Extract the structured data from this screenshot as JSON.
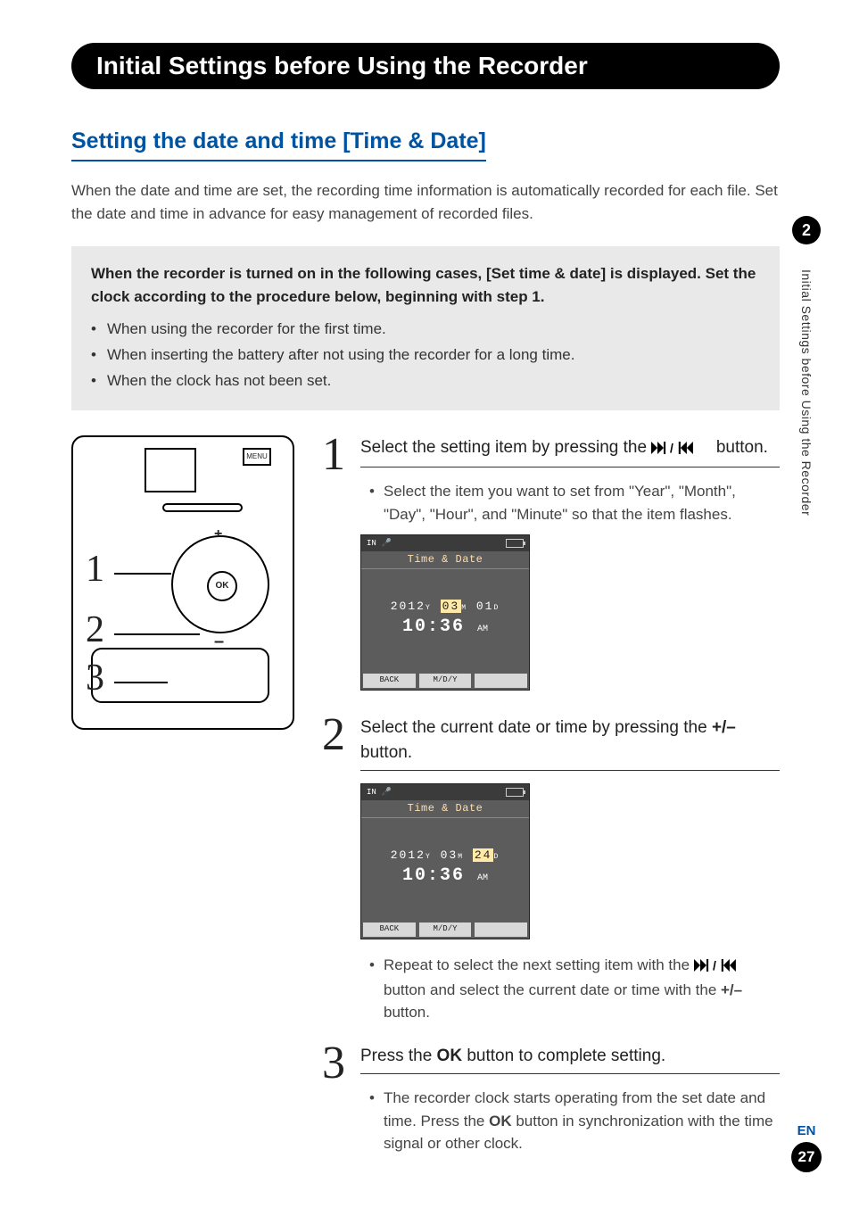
{
  "header": {
    "title": "Initial Settings before Using the Recorder"
  },
  "subheading": "Setting the date and time [Time & Date]",
  "intro": "When the date and time are set, the recording time information is automatically recorded for each file. Set the date and time in advance for easy management of recorded files.",
  "callout": {
    "heading": "When the recorder is turned on in the following cases, [Set time & date] is displayed. Set the clock according to the procedure below, beginning with step 1.",
    "items": [
      "When using the recorder for the first time.",
      "When inserting the battery after not using the recorder for a long time.",
      "When the clock has not been set."
    ]
  },
  "device": {
    "menu_label": "MENU",
    "ok_label": "OK",
    "plus": "+",
    "minus": "–",
    "callouts": {
      "n1": "1",
      "n2": "2",
      "n3": "3"
    }
  },
  "steps": {
    "s1": {
      "num": "1",
      "title_before": "Select the setting item by pressing the ",
      "title_after": " button.",
      "bullet1": "Select the item you want to set from \"Year\", \"Month\", \"Day\", \"Hour\", and \"Minute\" so that the item flashes."
    },
    "s2": {
      "num": "2",
      "title_before": "Select the current date or time by pressing the ",
      "pm_label": "+/–",
      "title_after": " button.",
      "bullet_a": "Repeat to select the next setting item with the ",
      "bullet_b": " button and select the current date or time with the ",
      "bullet_c": " button."
    },
    "s3": {
      "num": "3",
      "title_before": "Press the ",
      "ok_label": "OK",
      "title_after": " button to complete setting.",
      "bullet_a": "The recorder clock starts operating from the set date and time. Press the ",
      "bullet_b": " button in synchronization with the time signal or other clock."
    }
  },
  "lcd": {
    "status_in": "IN",
    "label": "Time & Date",
    "soft_back": "BACK",
    "soft_fmt": "M/D/Y",
    "screen1": {
      "date_y": "2012",
      "date_m": "03",
      "date_d": "01",
      "y_suffix": "Y",
      "m_suffix": "M",
      "d_suffix": "D",
      "time": "10:36",
      "ampm": "AM",
      "highlight": "month"
    },
    "screen2": {
      "date_y": "2012",
      "date_m": "03",
      "date_d": "24",
      "y_suffix": "Y",
      "m_suffix": "M",
      "d_suffix": "D",
      "time": "10:36",
      "ampm": "AM",
      "highlight": "day"
    }
  },
  "side": {
    "chapter": "2",
    "vertical": "Initial Settings before Using the Recorder",
    "lang": "EN",
    "page": "27"
  }
}
